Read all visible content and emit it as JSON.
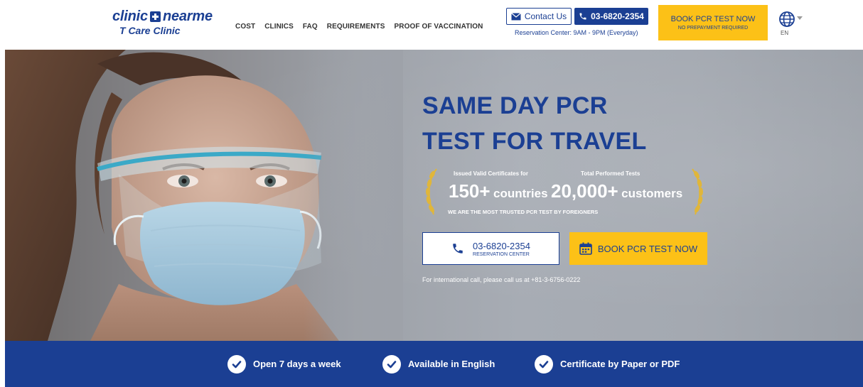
{
  "header": {
    "logo": {
      "brand_part1": "clinic",
      "brand_part2": "nearme",
      "sub": "T Care Clinic"
    },
    "nav": [
      {
        "label": "COST"
      },
      {
        "label": "CLINICS"
      },
      {
        "label": "FAQ"
      },
      {
        "label": "REQUIREMENTS"
      },
      {
        "label": "PROOF OF VACCINATION"
      }
    ],
    "contact_label": "Contact Us",
    "phone_label": "03-6820-2354",
    "reservation_hours": "Reservation Center: 9AM - 9PM (Everyday)",
    "book_label": "BOOK PCR TEST NOW",
    "book_sub": "NO PREPAYMENT REQUIRED",
    "lang_code": "EN"
  },
  "hero": {
    "title_line1": "SAME DAY PCR",
    "title_line2": "TEST FOR TRAVEL",
    "stat1_label": "Issued Valid Certificates for",
    "stat1_number": "150+",
    "stat1_unit": "countries",
    "stat2_label": "Total Performed Tests",
    "stat2_number": "20,000+",
    "stat2_unit": "customers",
    "trust_text": "WE ARE THE MOST TRUSTED PCR TEST BY FOREIGNERS",
    "call_number": "03-6820-2354",
    "call_sub": "RESERVATION CENTER",
    "book_label": "BOOK PCR TEST NOW",
    "intl_note": "For international call, please call us at +81-3-6756-0222"
  },
  "features": [
    {
      "label": "Open 7 days a week"
    },
    {
      "label": "Available in English"
    },
    {
      "label": "Certificate by Paper or PDF"
    }
  ],
  "colors": {
    "brand_blue": "#1b3f93",
    "accent_yellow": "#fcc117",
    "laurel_gold": "#e0b63a"
  }
}
